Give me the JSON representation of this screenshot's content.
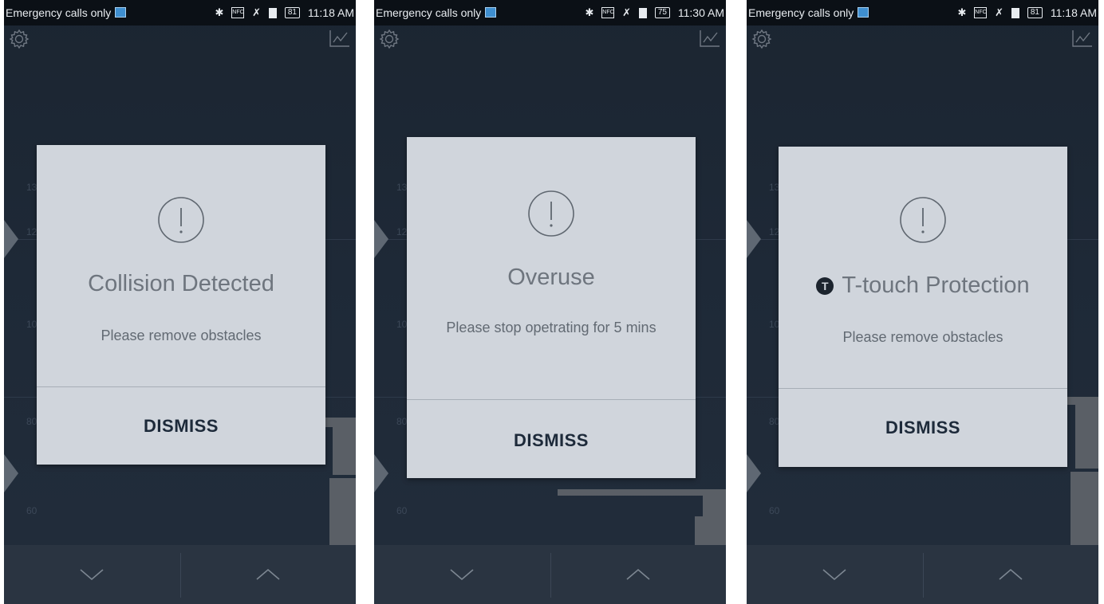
{
  "screens": [
    {
      "status": {
        "carrier": "Emergency calls only",
        "battery": "81",
        "time": "11:18 AM"
      },
      "dialog": {
        "title": "Collision Detected",
        "message": "Please remove obstacles",
        "button": "DISMISS"
      }
    },
    {
      "status": {
        "carrier": "Emergency calls only",
        "battery": "75",
        "time": "11:30 AM"
      },
      "dialog": {
        "title": "Overuse",
        "message": "Please stop opetrating for 5 mins",
        "button": "DISMISS"
      }
    },
    {
      "status": {
        "carrier": "Emergency calls only",
        "battery": "81",
        "time": "11:18 AM"
      },
      "dialog": {
        "title": "T-touch Protection",
        "message": "Please remove obstacles",
        "button": "DISMISS",
        "title_icon": "t-touch-icon"
      }
    }
  ],
  "scale_ticks": [
    "13",
    "12",
    "10",
    "80",
    "60"
  ],
  "icons": {
    "settings": "gear-icon",
    "stats": "chart-icon",
    "down": "chevron-down-icon",
    "up": "chevron-up-icon",
    "alert": "exclamation-circle-icon"
  },
  "colors": {
    "dialog_bg": "#d0d5dc",
    "button_text": "#1d2a3a",
    "background": "#1e2937"
  }
}
